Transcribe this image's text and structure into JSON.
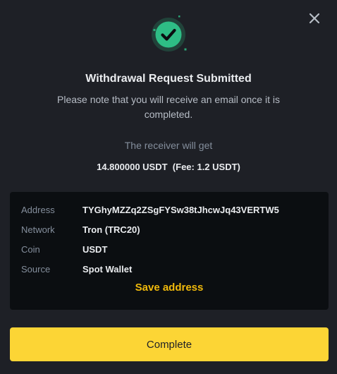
{
  "dialog": {
    "title": "Withdrawal Request Submitted",
    "subtitle": "Please note that you will receive an email once it is completed.",
    "receiver_label": "The receiver will get",
    "amount": "14.800000 USDT",
    "fee": "(Fee: 1.2 USDT)",
    "close_icon": "close-icon",
    "status_icon": "check-circle-icon"
  },
  "details": {
    "rows": [
      {
        "label": "Address",
        "value": "TYGhyMZZq2ZSgFYSw38tJhcwJq43VERTW5"
      },
      {
        "label": "Network",
        "value": "Tron (TRC20)"
      },
      {
        "label": "Coin",
        "value": "USDT"
      },
      {
        "label": "Source",
        "value": "Spot Wallet"
      }
    ],
    "save_address_label": "Save address"
  },
  "actions": {
    "complete_label": "Complete"
  },
  "colors": {
    "background": "#1e2026",
    "panel": "#0b0e11",
    "accent_yellow": "#fcd535",
    "link_yellow": "#f0b90b",
    "success_green": "#2ebd85"
  }
}
